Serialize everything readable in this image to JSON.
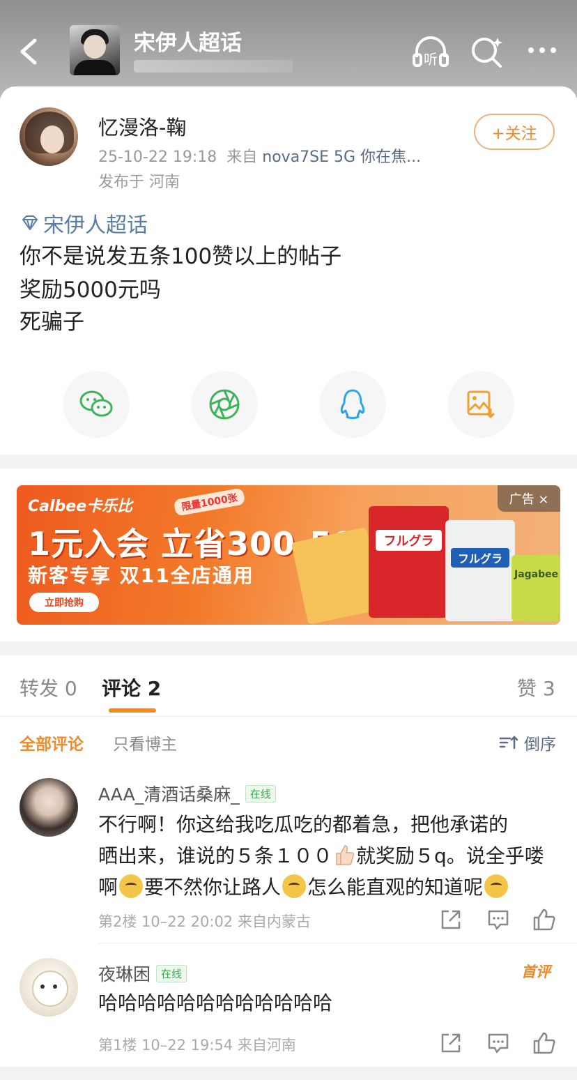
{
  "header": {
    "title": "宋伊人超话",
    "icons": [
      "back-icon",
      "headphone-listen-icon",
      "search-sparkle-icon",
      "more-icon"
    ],
    "listen_label": "听"
  },
  "post": {
    "author": "忆漫洛-鞠",
    "time": "25-10-22 19:18",
    "source_prefix": "来自",
    "device": "nova7SE 5G 你在焦...",
    "location": "发布于 河南",
    "follow_label": "+关注",
    "topic": "宋伊人超话",
    "lines": [
      "你不是说发五条100赞以上的帖子",
      "奖励5000元吗",
      "死骗子"
    ],
    "share_icons": [
      "wechat-icon",
      "moments-icon",
      "qq-icon",
      "save-image-icon"
    ]
  },
  "ad": {
    "brand": "Calbee卡乐比",
    "limited": "限量1000张",
    "headline": "1元入会 立省300-50",
    "subline": "新客专享 双11全店通用",
    "cta": "立即抢购",
    "tag": "广告 ×",
    "product_labels": [
      "フルグラ",
      "フルグラ",
      "Jagabee"
    ]
  },
  "tabs": {
    "repost": "转发 0",
    "comments": "评论 2",
    "likes": "赞 3",
    "filter_all": "全部评论",
    "filter_author": "只看博主",
    "sort": "倒序"
  },
  "comments": [
    {
      "name": "AAA_清酒话桑麻_",
      "online": "在线",
      "text_1": "不行啊！你这给我吃瓜吃的都着急，把他承诺的",
      "text_2a": "晒出来，谁说的５条１００",
      "text_2b": "就奖励５q。说全乎喽",
      "text_3a": "啊",
      "text_3b": "要不然你让路人",
      "text_3c": "怎么能直观的知道呢",
      "meta": "第2楼 10–22 20:02 来自内蒙古"
    },
    {
      "name": "夜琳困",
      "online": "在线",
      "badge": "首评",
      "text_1": "哈哈哈哈哈哈哈哈哈哈哈哈",
      "meta": "第1楼 10–22 19:54 来自河南"
    }
  ],
  "colors": {
    "accent": "#f08a2a",
    "link": "#5a7ca8",
    "online_green": "#3aa84a"
  }
}
